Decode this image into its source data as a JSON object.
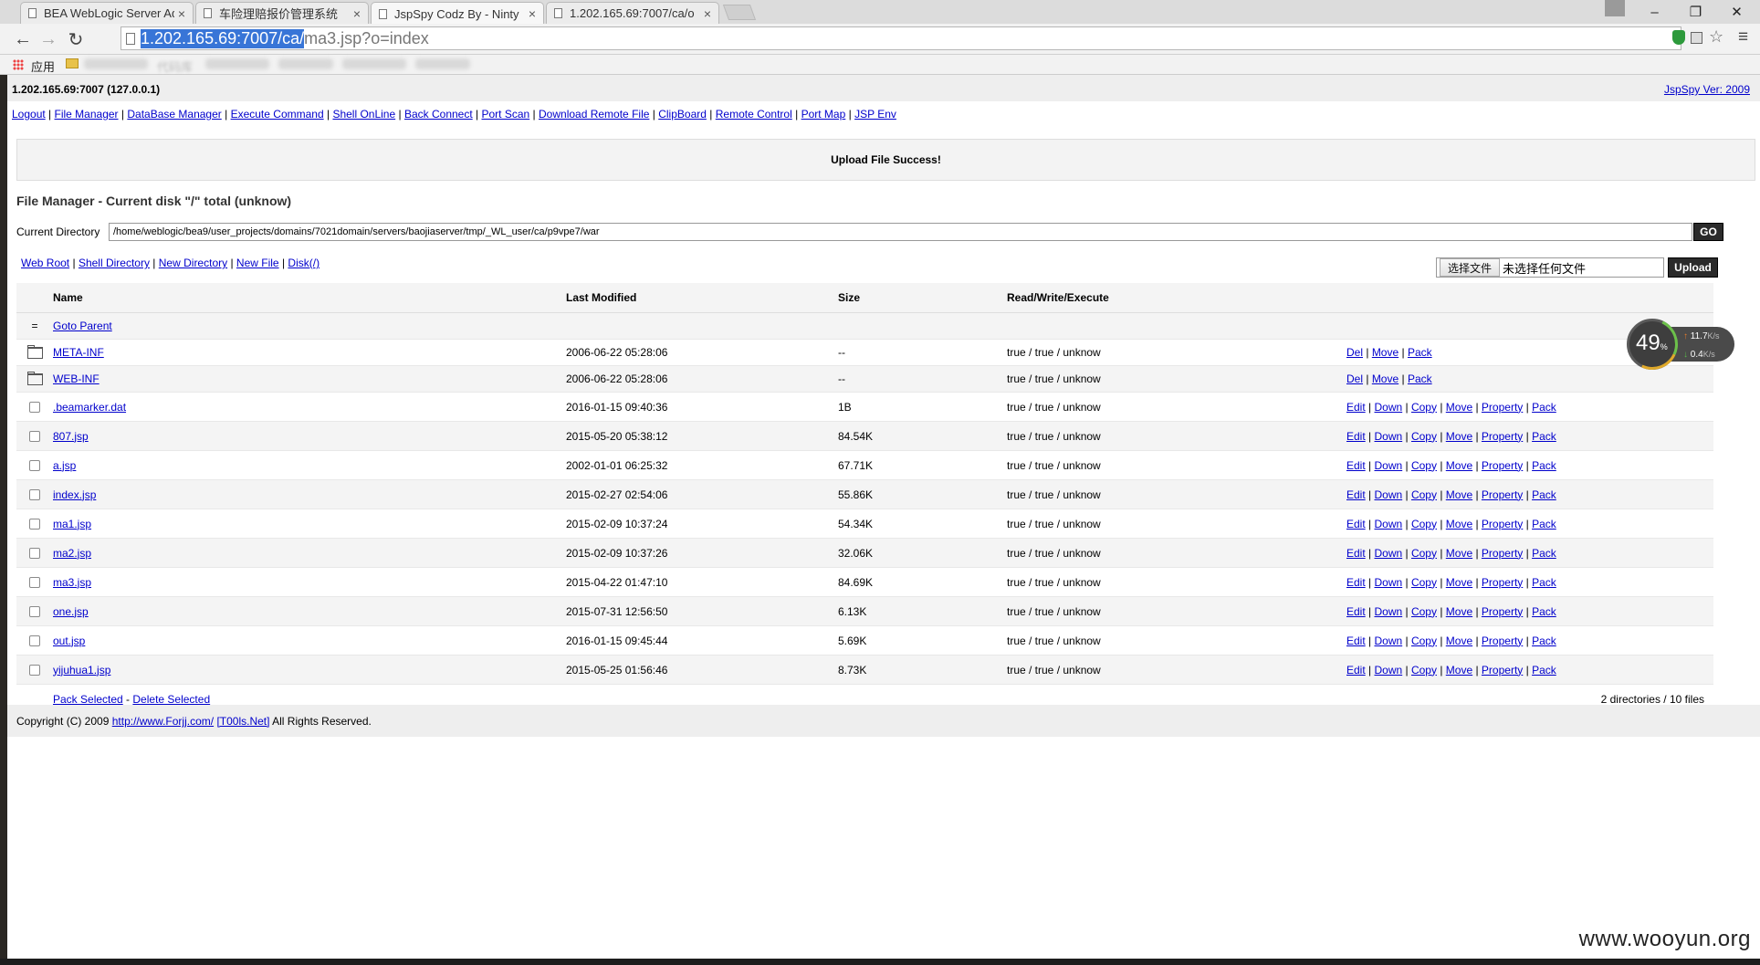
{
  "browser": {
    "tabs": [
      {
        "label": "BEA WebLogic Server Ad",
        "active": false
      },
      {
        "label": "车险理赔报价管理系统",
        "active": false
      },
      {
        "label": "JspSpy Codz By - Ninty",
        "active": true
      },
      {
        "label": "1.202.165.69:7007/ca/o",
        "active": false
      }
    ],
    "tab_close": "×",
    "window_controls": {
      "minimize": "–",
      "restore": "❐",
      "close": "✕"
    },
    "nav": {
      "back": "←",
      "forward": "→",
      "reload": "↻"
    },
    "url_selected": "1.202.165.69:7007/ca/",
    "url_rest": "ma3.jsp?o=index",
    "bookmarks": {
      "apps_label": "应用",
      "folder_label": "代码库"
    },
    "menu_icon": "≡",
    "star_icon": "☆"
  },
  "page": {
    "host": "1.202.165.69:7007 (127.0.0.1)",
    "version": "JspSpy Ver: 2009",
    "menu": [
      "Logout",
      "File Manager",
      "DataBase Manager",
      "Execute Command",
      "Shell OnLine",
      "Back Connect",
      "Port Scan",
      "Download Remote File",
      "ClipBoard",
      "Remote Control",
      "Port Map",
      "JSP Env"
    ],
    "message": "Upload File Success!",
    "fm_title": "File Manager - Current disk \"/\" total (unknow)",
    "current_dir_label": "Current Directory",
    "current_dir_value": "/home/weblogic/bea9/user_projects/domains/7021domain/servers/baojiaserver/tmp/_WL_user/ca/p9vpe7/war",
    "go_label": "GO",
    "shortcuts": [
      "Web Root",
      "Shell Directory",
      "New Directory",
      "New File",
      "Disk(/)"
    ],
    "choose_file_label": "选择文件",
    "no_file_label": "未选择任何文件",
    "upload_label": "Upload",
    "columns": {
      "name": "Name",
      "modified": "Last Modified",
      "size": "Size",
      "perm": "Read/Write/Execute"
    },
    "goto_parent_icon": "=",
    "goto_parent": "Goto Parent",
    "directories": [
      {
        "name": "META-INF",
        "modified": "2006-06-22 05:28:06",
        "size": "--",
        "perm": "true / true / unknow"
      },
      {
        "name": "WEB-INF",
        "modified": "2006-06-22 05:28:06",
        "size": "--",
        "perm": "true / true / unknow"
      }
    ],
    "dir_actions": [
      "Del",
      "Move",
      "Pack"
    ],
    "files": [
      {
        "name": ".beamarker.dat",
        "modified": "2016-01-15 09:40:36",
        "size": "1B",
        "perm": "true / true / unknow"
      },
      {
        "name": "807.jsp",
        "modified": "2015-05-20 05:38:12",
        "size": "84.54K",
        "perm": "true / true / unknow"
      },
      {
        "name": "a.jsp",
        "modified": "2002-01-01 06:25:32",
        "size": "67.71K",
        "perm": "true / true / unknow"
      },
      {
        "name": "index.jsp",
        "modified": "2015-02-27 02:54:06",
        "size": "55.86K",
        "perm": "true / true / unknow"
      },
      {
        "name": "ma1.jsp",
        "modified": "2015-02-09 10:37:24",
        "size": "54.34K",
        "perm": "true / true / unknow"
      },
      {
        "name": "ma2.jsp",
        "modified": "2015-02-09 10:37:26",
        "size": "32.06K",
        "perm": "true / true / unknow"
      },
      {
        "name": "ma3.jsp",
        "modified": "2015-04-22 01:47:10",
        "size": "84.69K",
        "perm": "true / true / unknow"
      },
      {
        "name": "one.jsp",
        "modified": "2015-07-31 12:56:50",
        "size": "6.13K",
        "perm": "true / true / unknow"
      },
      {
        "name": "out.jsp",
        "modified": "2016-01-15 09:45:44",
        "size": "5.69K",
        "perm": "true / true / unknow"
      },
      {
        "name": "yijuhua1.jsp",
        "modified": "2015-05-25 01:56:46",
        "size": "8.73K",
        "perm": "true / true / unknow"
      }
    ],
    "file_actions": [
      "Edit",
      "Down",
      "Copy",
      "Move",
      "Property",
      "Pack"
    ],
    "pack_selected": "Pack Selected",
    "delete_selected": "Delete Selected",
    "summary": "2 directories / 10 files",
    "footer_copyright": "Copyright (C) 2009",
    "footer_link1": "http://www.Forjj.com/",
    "footer_link2": "[T00ls.Net]",
    "footer_rights": "All Rights Reserved."
  },
  "speed_widget": {
    "percent": "49",
    "percent_unit": "%",
    "up": "11.7",
    "down": "0.4",
    "unit": "K/s",
    "up_icon": "↑",
    "down_icon": "↓"
  },
  "watermark": "www.wooyun.org"
}
